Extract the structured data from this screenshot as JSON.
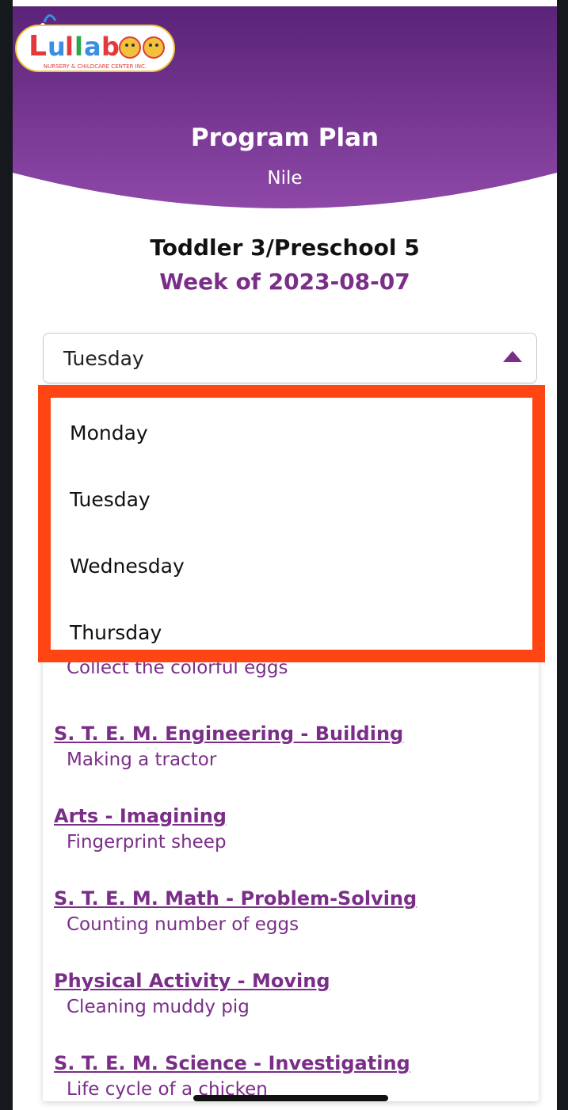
{
  "header": {
    "title": "Program Plan",
    "subtitle": "Nile",
    "logo_text": "Lullaboo",
    "logo_tagline": "NURSERY & CHILDCARE CENTER INC."
  },
  "class_name": "Toddler 3/Preschool 5",
  "week_label": "Week of 2023-08-07",
  "day_select": {
    "value": "Tuesday",
    "options": [
      "Monday",
      "Tuesday",
      "Wednesday",
      "Thursday"
    ]
  },
  "activities": [
    {
      "title": "",
      "description": "Collect the colorful eggs"
    },
    {
      "title": "S. T. E. M.  Engineering - Building",
      "description": "Making a tractor"
    },
    {
      "title": "Arts - Imagining",
      "description": "Fingerprint sheep"
    },
    {
      "title": "S. T. E. M. Math - Problem-Solving",
      "description": "Counting number of eggs"
    },
    {
      "title": "Physical Activity - Moving",
      "description": "Cleaning muddy pig"
    },
    {
      "title": "S. T. E. M. Science - Investigating",
      "description": "Life cycle of a chicken"
    }
  ],
  "colors": {
    "brand_purple": "#7a2e88",
    "header_top": "#5a2378",
    "header_bottom": "#8e48a8",
    "highlight": "#ff4514"
  },
  "icons": {
    "back": "arrow-left-icon",
    "dropdown": "caret-up-icon"
  }
}
